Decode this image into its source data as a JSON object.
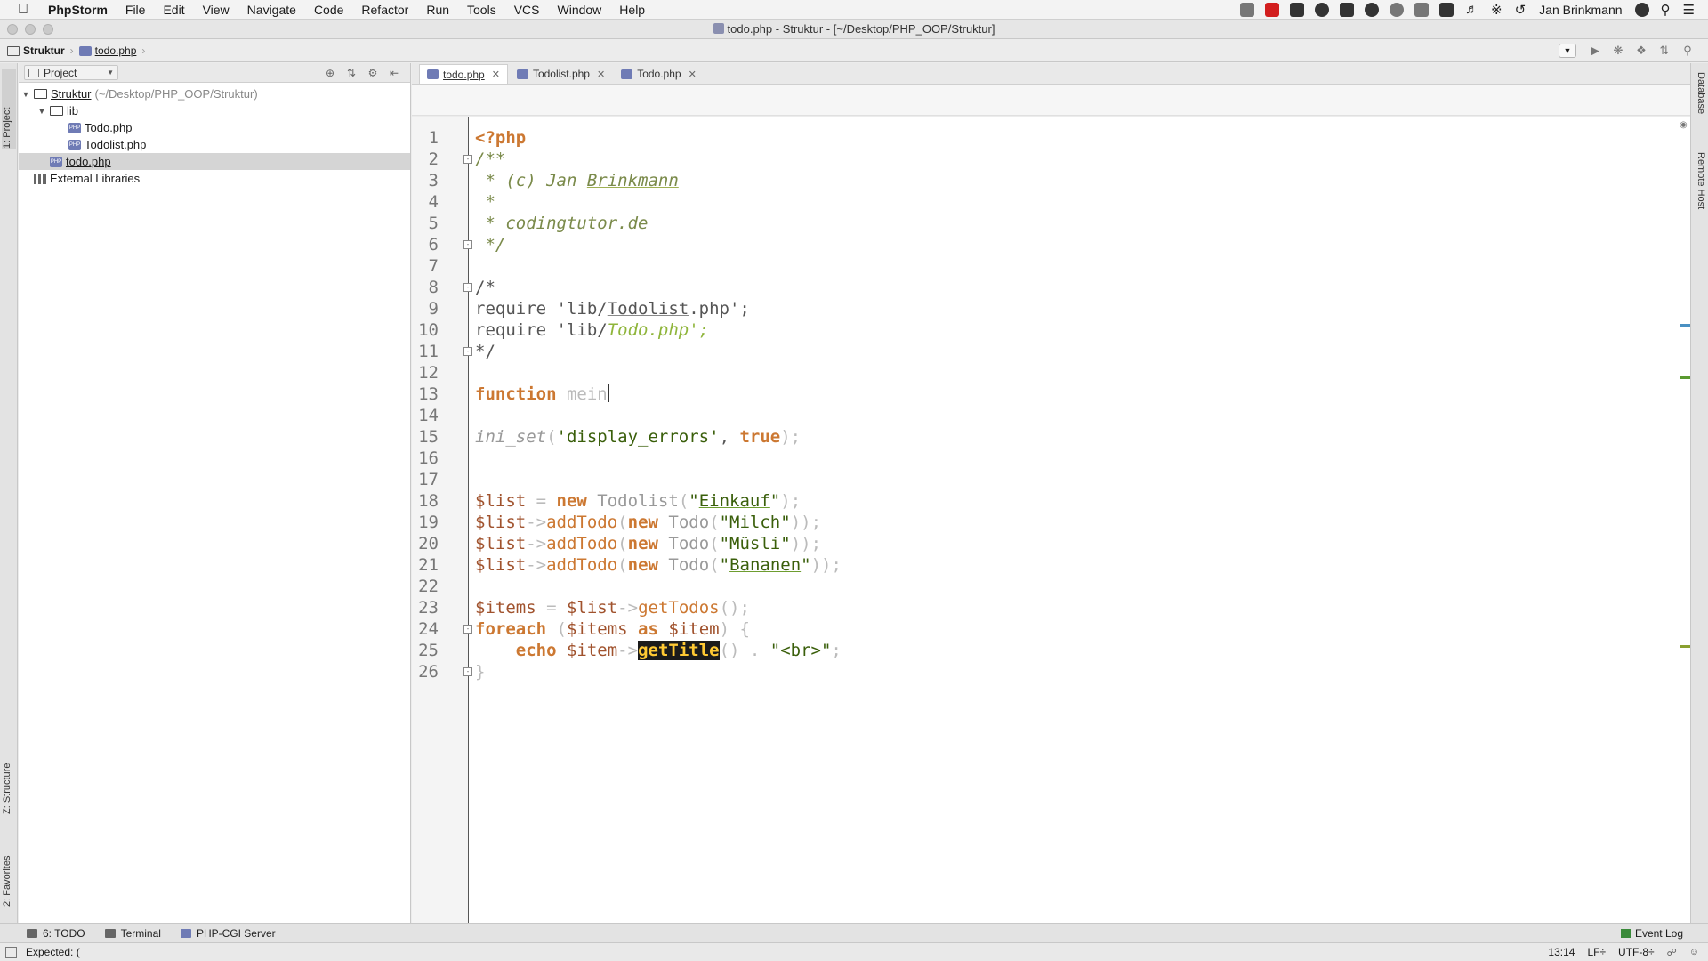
{
  "menubar": {
    "app_name": "PhpStorm",
    "items": [
      "File",
      "Edit",
      "View",
      "Navigate",
      "Code",
      "Refactor",
      "Run",
      "Tools",
      "VCS",
      "Window",
      "Help"
    ],
    "user": "Jan Brinkmann"
  },
  "window": {
    "title": "todo.php - Struktur - [~/Desktop/PHP_OOP/Struktur]"
  },
  "navbar": {
    "crumbs": [
      "Struktur",
      "todo.php"
    ]
  },
  "left_strip": {
    "tabs": [
      "1: Project",
      "Z: Structure",
      "2: Favorites"
    ]
  },
  "right_strip": {
    "tabs": [
      "Database",
      "Remote Host"
    ]
  },
  "project_panel": {
    "view_label": "Project",
    "tree": [
      {
        "label": "Struktur",
        "hint": "(~/Desktop/PHP_OOP/Struktur)",
        "type": "folder",
        "depth": 0,
        "expanded": true
      },
      {
        "label": "lib",
        "type": "folder",
        "depth": 1,
        "expanded": true
      },
      {
        "label": "Todo.php",
        "type": "php",
        "depth": 2
      },
      {
        "label": "Todolist.php",
        "type": "php",
        "depth": 2
      },
      {
        "label": "todo.php",
        "type": "php",
        "depth": 1,
        "selected": true
      },
      {
        "label": "External Libraries",
        "type": "library",
        "depth": 0
      }
    ]
  },
  "editor": {
    "tabs": [
      {
        "label": "todo.php",
        "active": true
      },
      {
        "label": "Todolist.php",
        "active": false
      },
      {
        "label": "Todo.php",
        "active": false
      }
    ],
    "line_numbers": [
      "1",
      "2",
      "3",
      "4",
      "5",
      "6",
      "7",
      "8",
      "9",
      "10",
      "11",
      "12",
      "13",
      "14",
      "15",
      "16",
      "17",
      "18",
      "19",
      "20",
      "21",
      "22",
      "23",
      "24",
      "25",
      "26"
    ],
    "lines": [
      [
        [
          "kw",
          "<?php"
        ]
      ],
      [
        [
          "cm",
          "/**"
        ]
      ],
      [
        [
          "cm",
          " * (c) Jan "
        ],
        [
          "cm-u",
          "Brinkmann"
        ]
      ],
      [
        [
          "cm",
          " *"
        ]
      ],
      [
        [
          "cm",
          " * "
        ],
        [
          "cm-u",
          "codingtutor"
        ],
        [
          "cm",
          ".de"
        ]
      ],
      [
        [
          "cm",
          " */"
        ]
      ],
      [],
      [
        [
          "plain",
          "/*"
        ]
      ],
      [
        [
          "plain",
          "require 'lib/"
        ],
        [
          "plain-u",
          "Todolist"
        ],
        [
          "plain",
          ".php';"
        ]
      ],
      [
        [
          "plain",
          "require 'lib/"
        ],
        [
          "ital-str",
          "Todo.php';"
        ]
      ],
      [
        [
          "plain",
          "*/"
        ]
      ],
      [],
      [
        [
          "kw",
          "function "
        ],
        [
          "dim",
          "mein"
        ]
      ],
      [],
      [
        [
          "fn-i",
          "ini_set"
        ],
        [
          "dim",
          "("
        ],
        [
          "str",
          "'display_errors'"
        ],
        [
          "plain",
          ", "
        ],
        [
          "kw",
          "true"
        ],
        [
          "dim",
          ");"
        ]
      ],
      [],
      [],
      [
        [
          "var",
          "$list"
        ],
        [
          "dim",
          " = "
        ],
        [
          "kw",
          "new "
        ],
        [
          "cls",
          "Todolist"
        ],
        [
          "dim",
          "("
        ],
        [
          "str",
          "\""
        ],
        [
          "str-u",
          "Einkauf"
        ],
        [
          "str",
          "\""
        ],
        [
          "dim",
          ");"
        ]
      ],
      [
        [
          "var",
          "$list"
        ],
        [
          "dim",
          "->"
        ],
        [
          "fn",
          "addTodo"
        ],
        [
          "dim",
          "("
        ],
        [
          "kw",
          "new "
        ],
        [
          "cls",
          "Todo"
        ],
        [
          "dim",
          "("
        ],
        [
          "str",
          "\"Milch\""
        ],
        [
          "dim",
          "));"
        ]
      ],
      [
        [
          "var",
          "$list"
        ],
        [
          "dim",
          "->"
        ],
        [
          "fn",
          "addTodo"
        ],
        [
          "dim",
          "("
        ],
        [
          "kw",
          "new "
        ],
        [
          "cls",
          "Todo"
        ],
        [
          "dim",
          "("
        ],
        [
          "str",
          "\"Müsli\""
        ],
        [
          "dim",
          "));"
        ]
      ],
      [
        [
          "var",
          "$list"
        ],
        [
          "dim",
          "->"
        ],
        [
          "fn",
          "addTodo"
        ],
        [
          "dim",
          "("
        ],
        [
          "kw",
          "new "
        ],
        [
          "cls",
          "Todo"
        ],
        [
          "dim",
          "("
        ],
        [
          "str",
          "\""
        ],
        [
          "str-u",
          "Bananen"
        ],
        [
          "str",
          "\""
        ],
        [
          "dim",
          "));"
        ]
      ],
      [],
      [
        [
          "var",
          "$items"
        ],
        [
          "dim",
          " = "
        ],
        [
          "var",
          "$list"
        ],
        [
          "dim",
          "->"
        ],
        [
          "fn",
          "getTodos"
        ],
        [
          "dim",
          "();"
        ]
      ],
      [
        [
          "kw",
          "foreach "
        ],
        [
          "dim",
          "("
        ],
        [
          "var",
          "$items "
        ],
        [
          "kw",
          "as "
        ],
        [
          "var",
          "$item"
        ],
        [
          "dim",
          ") {"
        ]
      ],
      [
        [
          "plain",
          "    "
        ],
        [
          "kw",
          "echo "
        ],
        [
          "var",
          "$item"
        ],
        [
          "dim",
          "->"
        ],
        [
          "hl",
          "getTitle"
        ],
        [
          "dim",
          "() . "
        ],
        [
          "str",
          "\"<br>\""
        ],
        [
          "dim",
          ";"
        ]
      ],
      [
        [
          "dim",
          "}"
        ]
      ]
    ]
  },
  "bottombar": {
    "tools": [
      "6: TODO",
      "Terminal",
      "PHP-CGI Server"
    ],
    "event_log": "Event Log"
  },
  "statusbar": {
    "message": "Expected: (",
    "position": "13:14",
    "line_sep": "LF÷",
    "encoding": "UTF-8÷"
  },
  "colors": {
    "keyword": "#cc7832",
    "comment": "#7a8a4a",
    "string": "#3a5f0b",
    "variable": "#a0522d",
    "highlight_bg": "#1b1b1b",
    "highlight_fg": "#ffc933"
  }
}
